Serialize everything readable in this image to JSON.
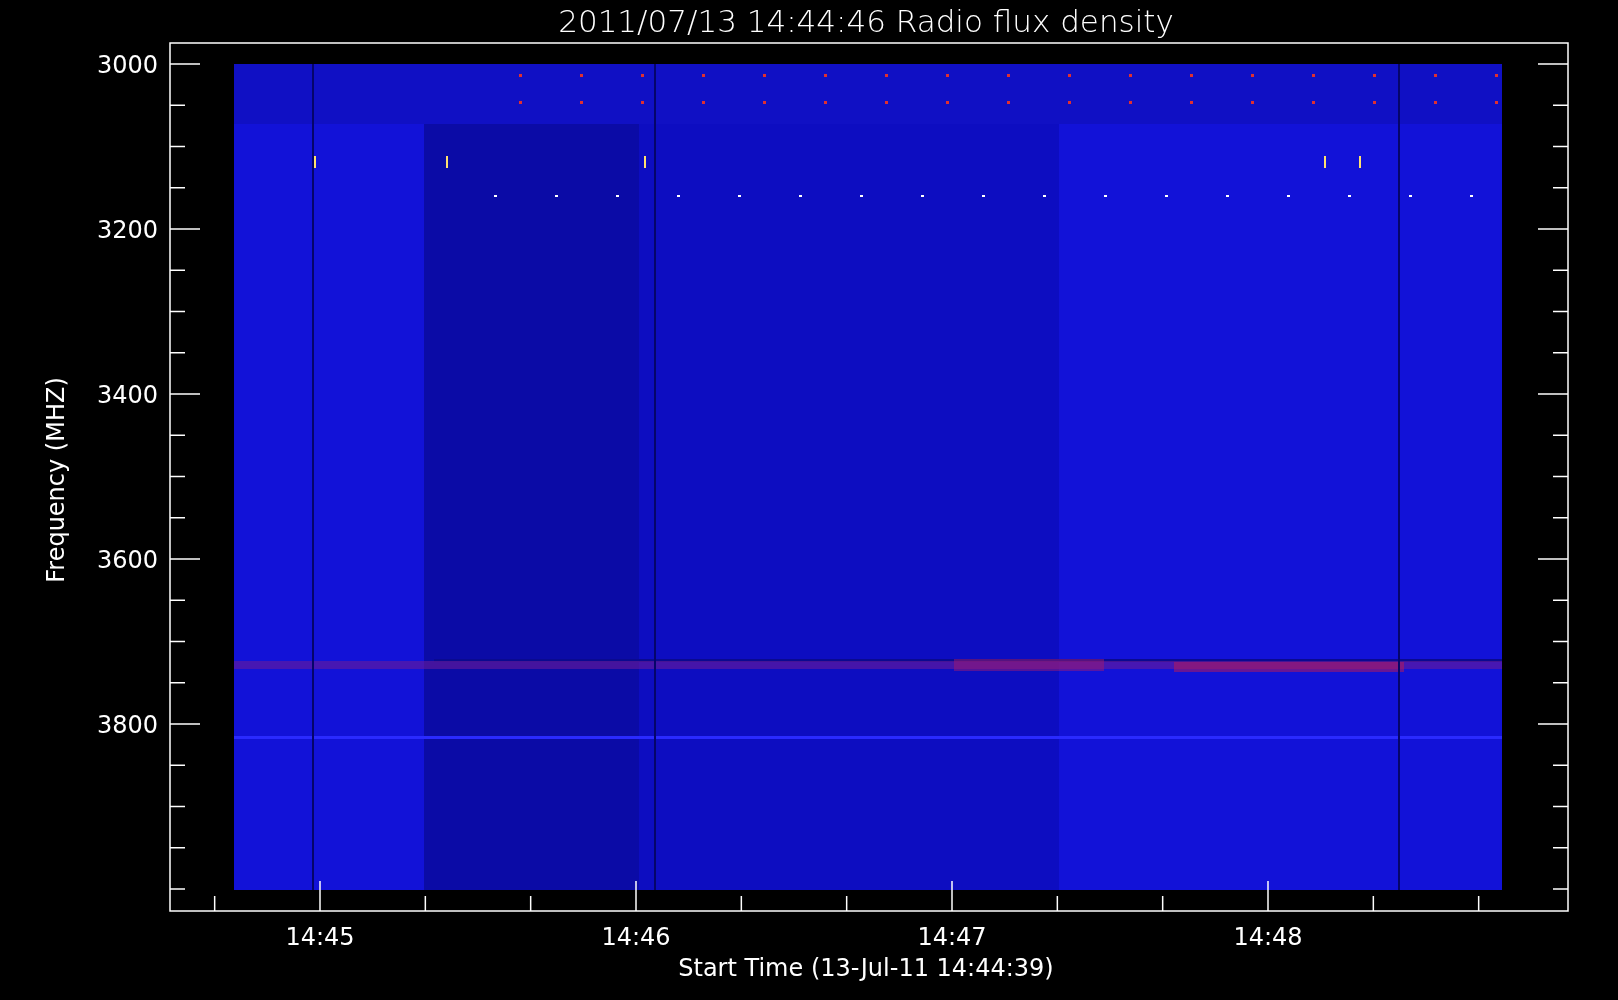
{
  "title": "2011/07/13 14:44:46 Radio flux density",
  "y_axis": {
    "label": "Frequency (MHZ)",
    "tick_labels": [
      "3000",
      "3200",
      "3400",
      "3600",
      "3800"
    ]
  },
  "x_axis": {
    "label": "Start Time (13-Jul-11 14:44:39)",
    "tick_labels": [
      "14:45",
      "14:46",
      "14:47",
      "14:48"
    ]
  }
}
